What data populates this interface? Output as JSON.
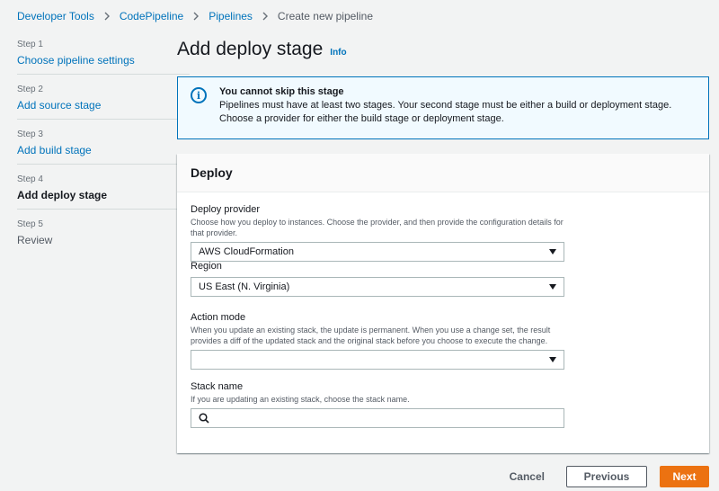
{
  "breadcrumb": {
    "items": [
      "Developer Tools",
      "CodePipeline",
      "Pipelines"
    ],
    "current": "Create new pipeline"
  },
  "steps": [
    {
      "num": "Step 1",
      "label": "Choose pipeline settings",
      "state": "done"
    },
    {
      "num": "Step 2",
      "label": "Add source stage",
      "state": "done"
    },
    {
      "num": "Step 3",
      "label": "Add build stage",
      "state": "done"
    },
    {
      "num": "Step 4",
      "label": "Add deploy stage",
      "state": "current"
    },
    {
      "num": "Step 5",
      "label": "Review",
      "state": "disabled"
    }
  ],
  "page": {
    "title": "Add deploy stage",
    "info": "Info"
  },
  "alert": {
    "icon": "info-icon",
    "title": "You cannot skip this stage",
    "text": "Pipelines must have at least two stages. Your second stage must be either a build or deployment stage. Choose a provider for either the build stage or deployment stage."
  },
  "panel": {
    "header": "Deploy",
    "deploy_provider": {
      "label": "Deploy provider",
      "description": "Choose how you deploy to instances. Choose the provider, and then provide the configuration details for that provider.",
      "value": "AWS CloudFormation"
    },
    "region": {
      "label": "Region",
      "value": "US East (N. Virginia)"
    },
    "action_mode": {
      "label": "Action mode",
      "description": "When you update an existing stack, the update is permanent. When you use a change set, the result provides a diff of the updated stack and the original stack before you choose to execute the change.",
      "value": ""
    },
    "stack_name": {
      "label": "Stack name",
      "description": "If you are updating an existing stack, choose the stack name.",
      "value": "",
      "placeholder": ""
    }
  },
  "footer": {
    "cancel": "Cancel",
    "previous": "Previous",
    "next": "Next"
  },
  "colors": {
    "link": "#0073bb",
    "primary": "#ec7211",
    "alert_bg": "#f1faff",
    "page_bg": "#f2f3f3"
  }
}
